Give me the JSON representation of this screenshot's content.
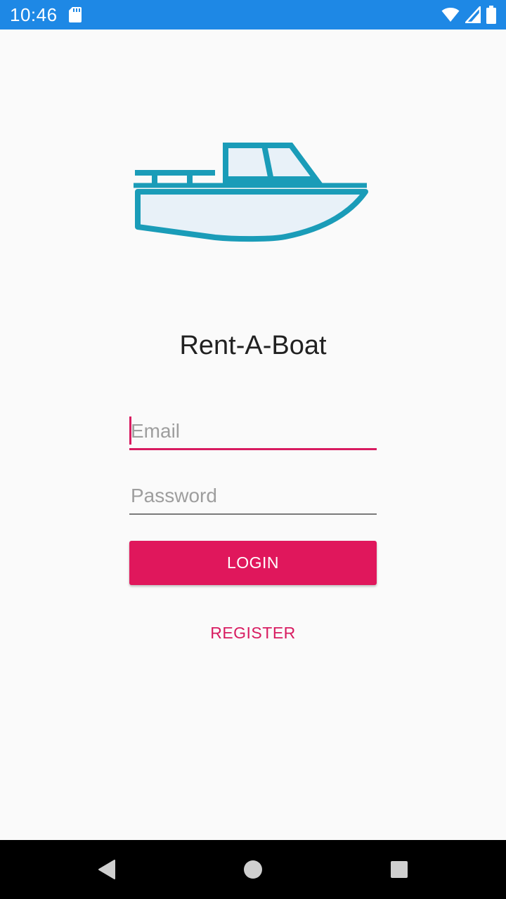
{
  "status_bar": {
    "time": "10:46",
    "icons": [
      "sd-card-icon",
      "wifi-icon",
      "signal-icon",
      "battery-icon"
    ]
  },
  "app": {
    "logo_icon": "boat-icon",
    "title": "Rent-A-Boat"
  },
  "form": {
    "email": {
      "placeholder": "Email",
      "value": "",
      "focused": true
    },
    "password": {
      "placeholder": "Password",
      "value": ""
    },
    "login_label": "LOGIN",
    "register_label": "REGISTER"
  },
  "nav": {
    "icons": [
      "back-icon",
      "home-icon",
      "recents-icon"
    ]
  },
  "colors": {
    "status_bar": "#1e88e5",
    "accent": "#e0175c",
    "logo_stroke": "#1a9cb8",
    "logo_fill": "#e8f1f8",
    "background": "#fafafa",
    "nav_bar": "#000000"
  }
}
